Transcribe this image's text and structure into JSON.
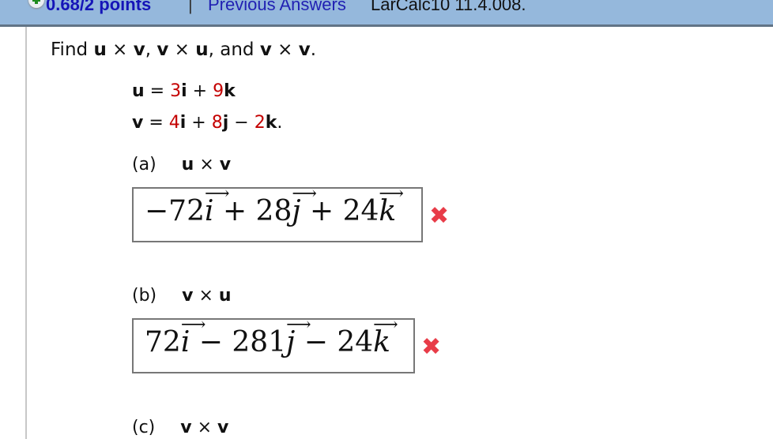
{
  "header": {
    "points": "0.68/2 points",
    "separator": "|",
    "previous_answers": "Previous Answers",
    "problem_code": "LarCalc10 11.4.008."
  },
  "question": {
    "intro_parts": [
      "Find ",
      "u",
      " × ",
      "v",
      ", ",
      "v",
      " × ",
      "u",
      ", and ",
      "v",
      " × ",
      "v",
      "."
    ],
    "u": {
      "lhs": "u",
      "eq": " = ",
      "c1": "3",
      "b1": "i",
      "op1": " + ",
      "c2": "9",
      "b2": "k",
      "end": ""
    },
    "v": {
      "lhs": "v",
      "eq": " = ",
      "c1": "4",
      "b1": "i",
      "op1": " + ",
      "c2": "8",
      "b2": "j",
      "op2": " − ",
      "c3": "2",
      "b3": "k",
      "end": "."
    }
  },
  "parts": [
    {
      "label": "(a)",
      "expr_a": "u",
      "op": " × ",
      "expr_b": "v",
      "answer": {
        "t1": "−72",
        "v1": "i",
        "t2": " + 28",
        "v2": "j",
        "t3": " + 24",
        "v3": "k"
      },
      "status": "incorrect",
      "status_icon": "✖"
    },
    {
      "label": "(b)",
      "expr_a": "v",
      "op": " × ",
      "expr_b": "u",
      "answer": {
        "t1": "72",
        "v1": "i",
        "t2": " − 281",
        "v2": "j",
        "t3": " − 24",
        "v3": "k"
      },
      "status": "incorrect",
      "status_icon": "✖"
    },
    {
      "label": "(c)",
      "expr_a": "v",
      "op": " × ",
      "expr_b": "v"
    }
  ],
  "colors": {
    "header_bg": "#95b8dc",
    "link": "#2121b3",
    "coefficient": "#c40000",
    "error": "#e83c48"
  }
}
